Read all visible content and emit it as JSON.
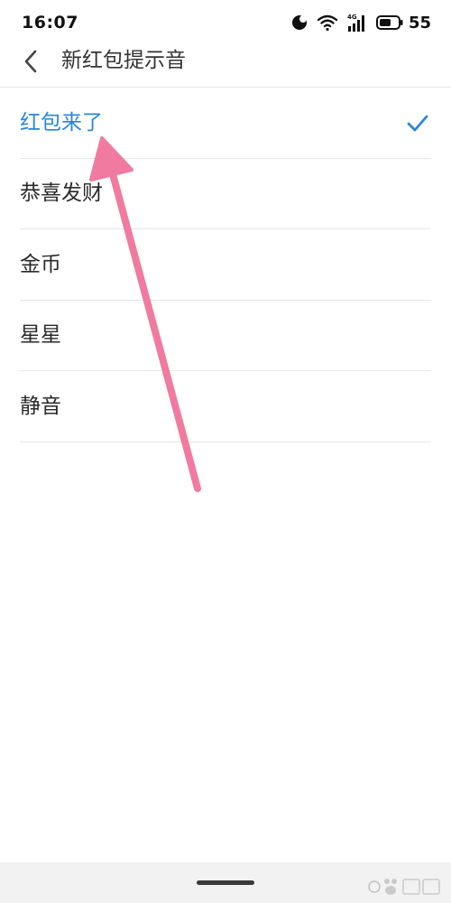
{
  "status_bar": {
    "time": "16:07",
    "network": "4G",
    "battery": "55",
    "icons": [
      "do-not-disturb-icon",
      "wifi-icon",
      "signal-icon",
      "battery-icon"
    ]
  },
  "header": {
    "back_icon": "chevron-left-icon",
    "title": "新红包提示音"
  },
  "sound_list": {
    "items": [
      {
        "label": "红包来了",
        "selected": true
      },
      {
        "label": "恭喜发财",
        "selected": false
      },
      {
        "label": "金币",
        "selected": false
      },
      {
        "label": "星星",
        "selected": false
      },
      {
        "label": "静音",
        "selected": false
      }
    ],
    "selected_icon": "checkmark-icon"
  },
  "colors": {
    "accent": "#2b86d6",
    "annotation_arrow": "#f07aa0",
    "divider": "#e7e7e7"
  }
}
